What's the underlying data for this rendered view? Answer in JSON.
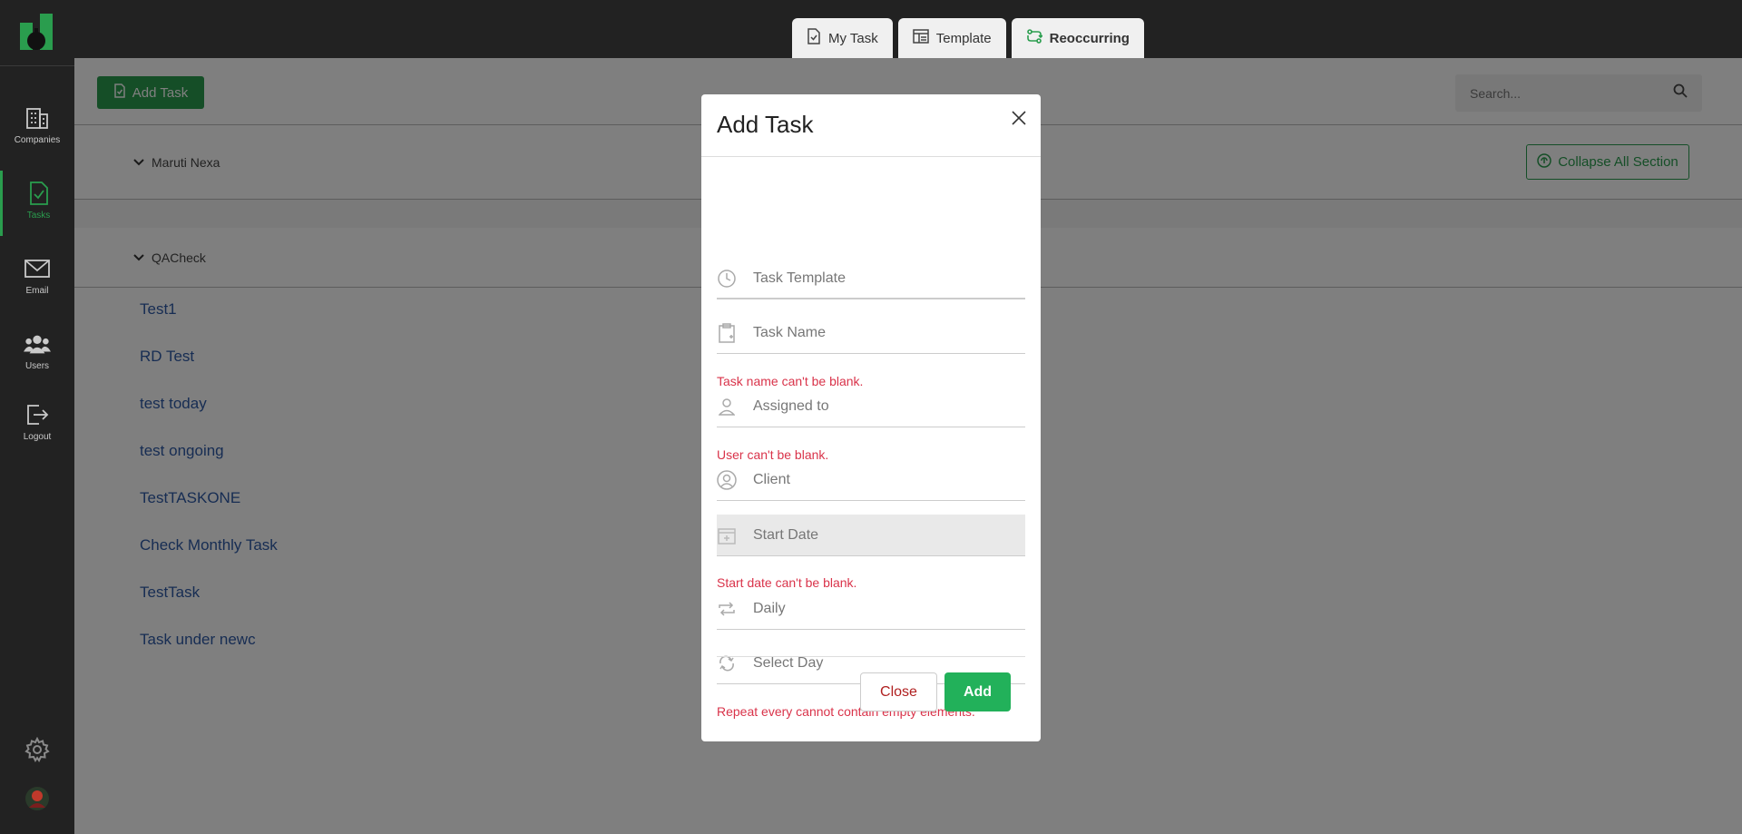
{
  "colors": {
    "brand": "#2a9d4e",
    "sidebar_bg": "#222222",
    "error": "#d9334a",
    "link": "#2e5aa6",
    "add_button": "#22b15a",
    "close_text": "#b02020"
  },
  "sidebar": {
    "logo_icon": "app-logo-icon",
    "items": [
      {
        "label": "Companies",
        "icon": "building-icon"
      },
      {
        "label": "Tasks",
        "icon": "task-check-icon",
        "active": true
      },
      {
        "label": "Email",
        "icon": "envelope-icon"
      },
      {
        "label": "Users",
        "icon": "users-icon"
      },
      {
        "label": "Logout",
        "icon": "logout-icon"
      }
    ],
    "bottom_icons": [
      "gear-icon",
      "avatar"
    ]
  },
  "topbar": {
    "tabs": [
      {
        "label": "My Task",
        "icon": "task-file-icon"
      },
      {
        "label": "Template",
        "icon": "template-icon"
      },
      {
        "label": "Reoccurring",
        "icon": "recurring-icon",
        "active": true
      }
    ]
  },
  "main": {
    "add_task_label": "Add Task",
    "search_placeholder": "Search...",
    "collapse_label": "Collapse All Section",
    "sections": [
      {
        "name": "Maruti Nexa"
      },
      {
        "name": "QACheck"
      }
    ],
    "tasks": [
      "Test1",
      "RD Test",
      "test today",
      "test ongoing",
      "TestTASKONE",
      "Check Monthly Task",
      "TestTask",
      "Task under newc"
    ]
  },
  "modal": {
    "title": "Add Task",
    "fields": {
      "task_template": "Task Template",
      "task_name": "Task Name",
      "assigned_to": "Assigned to",
      "client": "Client",
      "start_date": "Start Date",
      "frequency": "Daily",
      "select_day": "Select Day"
    },
    "errors": {
      "task_name": "Task name can't be blank.",
      "user": "User can't be blank.",
      "start_date": "Start date can't be blank.",
      "repeat": "Repeat every cannot contain empty elements."
    },
    "close_label": "Close",
    "add_label": "Add"
  }
}
